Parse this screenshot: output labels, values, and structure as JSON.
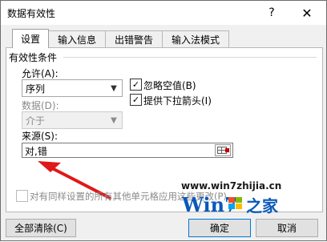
{
  "window": {
    "title": "数据有效性",
    "help_label": "?",
    "close_label": "✕"
  },
  "tabs": [
    {
      "label": "设置",
      "active": true
    },
    {
      "label": "输入信息",
      "active": false
    },
    {
      "label": "出错警告",
      "active": false
    },
    {
      "label": "输入法模式",
      "active": false
    }
  ],
  "validation": {
    "group_label": "有效性条件",
    "allow_label": "允许(A):",
    "allow_value": "序列",
    "data_label": "数据(D):",
    "data_value": "介于",
    "ignore_blank_label": "忽略空值(B)",
    "ignore_blank_checked": true,
    "dropdown_label": "提供下拉箭头(I)",
    "dropdown_checked": true,
    "source_label": "来源(S):",
    "source_value": "对,错"
  },
  "apply_all": {
    "label": "对有同样设置的所有其他单元格应用这些更改(P)",
    "checked": false
  },
  "footer": {
    "clear_all_label": "全部清除(C)",
    "ok_label": "确定",
    "cancel_label": "取消"
  },
  "watermark": {
    "url": "www.win7zhijia.cn",
    "logo_text": "Win7",
    "logo_suffix": "之家"
  },
  "colors": {
    "arrow": "#e01818",
    "accent": "#0078d7"
  },
  "icons": {
    "range_selector": "range-select-icon",
    "combo_arrow": "chevron-down-icon"
  }
}
